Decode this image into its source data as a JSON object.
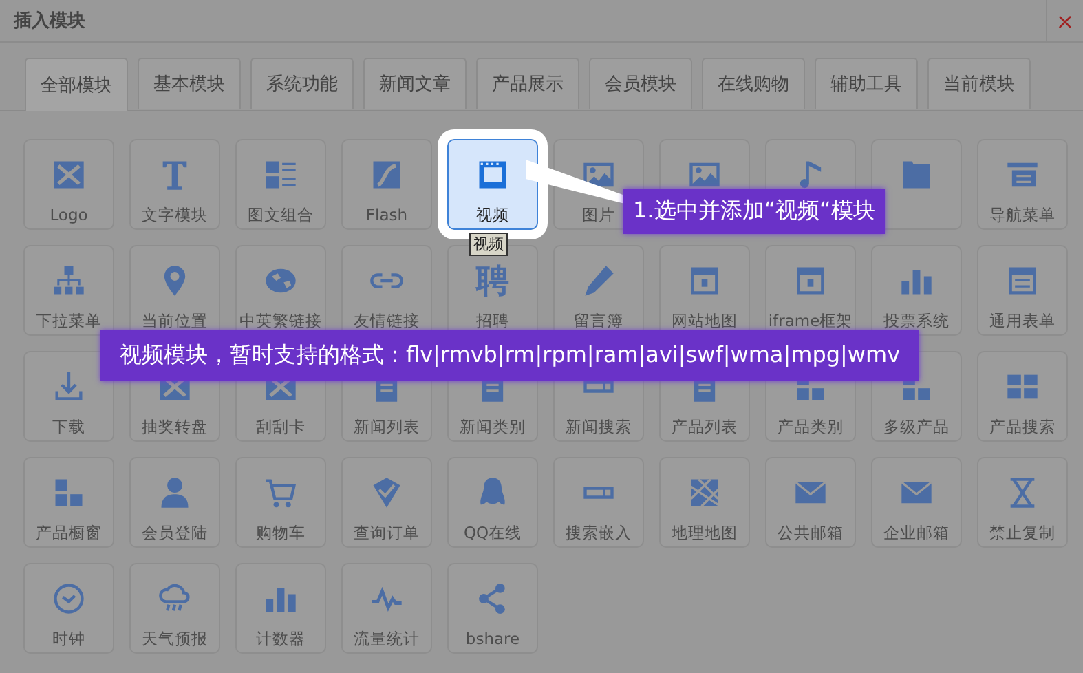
{
  "window": {
    "title": "插入模块",
    "close": "×"
  },
  "tabs": [
    {
      "label": "全部模块",
      "selected": true
    },
    {
      "label": "基本模块",
      "selected": false
    },
    {
      "label": "系统功能",
      "selected": false
    },
    {
      "label": "新闻文章",
      "selected": false
    },
    {
      "label": "产品展示",
      "selected": false
    },
    {
      "label": "会员模块",
      "selected": false
    },
    {
      "label": "在线购物",
      "selected": false
    },
    {
      "label": "辅助工具",
      "selected": false
    },
    {
      "label": "当前模块",
      "selected": false
    }
  ],
  "modules": [
    {
      "label": "Logo",
      "selected": false
    },
    {
      "label": "文字模块",
      "selected": false
    },
    {
      "label": "图文组合",
      "selected": false
    },
    {
      "label": "Flash",
      "selected": false
    },
    {
      "label": "视频",
      "selected": true
    },
    {
      "label": "图片",
      "selected": false
    },
    {
      "selected": false
    },
    {
      "selected": false
    },
    {
      "selected": false
    },
    {
      "label": "导航菜单",
      "selected": false
    },
    {
      "label": "下拉菜单",
      "selected": false
    },
    {
      "label": "当前位置",
      "selected": false
    },
    {
      "label": "中英繁链接",
      "selected": false
    },
    {
      "label": "友情链接",
      "selected": false
    },
    {
      "label": "招聘",
      "glyph": "聘",
      "selected": false
    },
    {
      "label": "留言簿",
      "selected": false
    },
    {
      "label": "网站地图",
      "selected": false
    },
    {
      "label": "iframe框架",
      "selected": false
    },
    {
      "label": "投票系统",
      "selected": false
    },
    {
      "label": "通用表单",
      "selected": false
    },
    {
      "label": "下载",
      "selected": false
    },
    {
      "label": "抽奖转盘",
      "selected": false
    },
    {
      "label": "刮刮卡",
      "selected": false
    },
    {
      "label": "新闻列表",
      "selected": false
    },
    {
      "label": "新闻类别",
      "selected": false
    },
    {
      "label": "新闻搜索",
      "selected": false
    },
    {
      "label": "产品列表",
      "selected": false
    },
    {
      "label": "产品类别",
      "selected": false
    },
    {
      "label": "多级产品",
      "selected": false
    },
    {
      "label": "产品搜索",
      "selected": false
    },
    {
      "label": "产品橱窗",
      "selected": false
    },
    {
      "label": "会员登陆",
      "selected": false
    },
    {
      "label": "购物车",
      "selected": false
    },
    {
      "label": "查询订单",
      "selected": false
    },
    {
      "label": "QQ在线",
      "selected": false
    },
    {
      "label": "搜索嵌入",
      "selected": false
    },
    {
      "label": "地理地图",
      "selected": false
    },
    {
      "label": "公共邮箱",
      "selected": false
    },
    {
      "label": "企业邮箱",
      "selected": false
    },
    {
      "label": "禁止复制",
      "selected": false
    },
    {
      "label": "时钟",
      "selected": false
    },
    {
      "label": "天气预报",
      "selected": false
    },
    {
      "label": "计数器",
      "selected": false
    },
    {
      "label": "流量统计",
      "selected": false
    },
    {
      "label": "bshare",
      "selected": false
    }
  ],
  "tooltip": "视频",
  "callouts": [
    "1.选中并添加“视频“模块",
    "视频模块，暂时支持的格式：flv|rmvb|rm|rpm|ram|avi|swf|wma|mpg|wmv"
  ]
}
